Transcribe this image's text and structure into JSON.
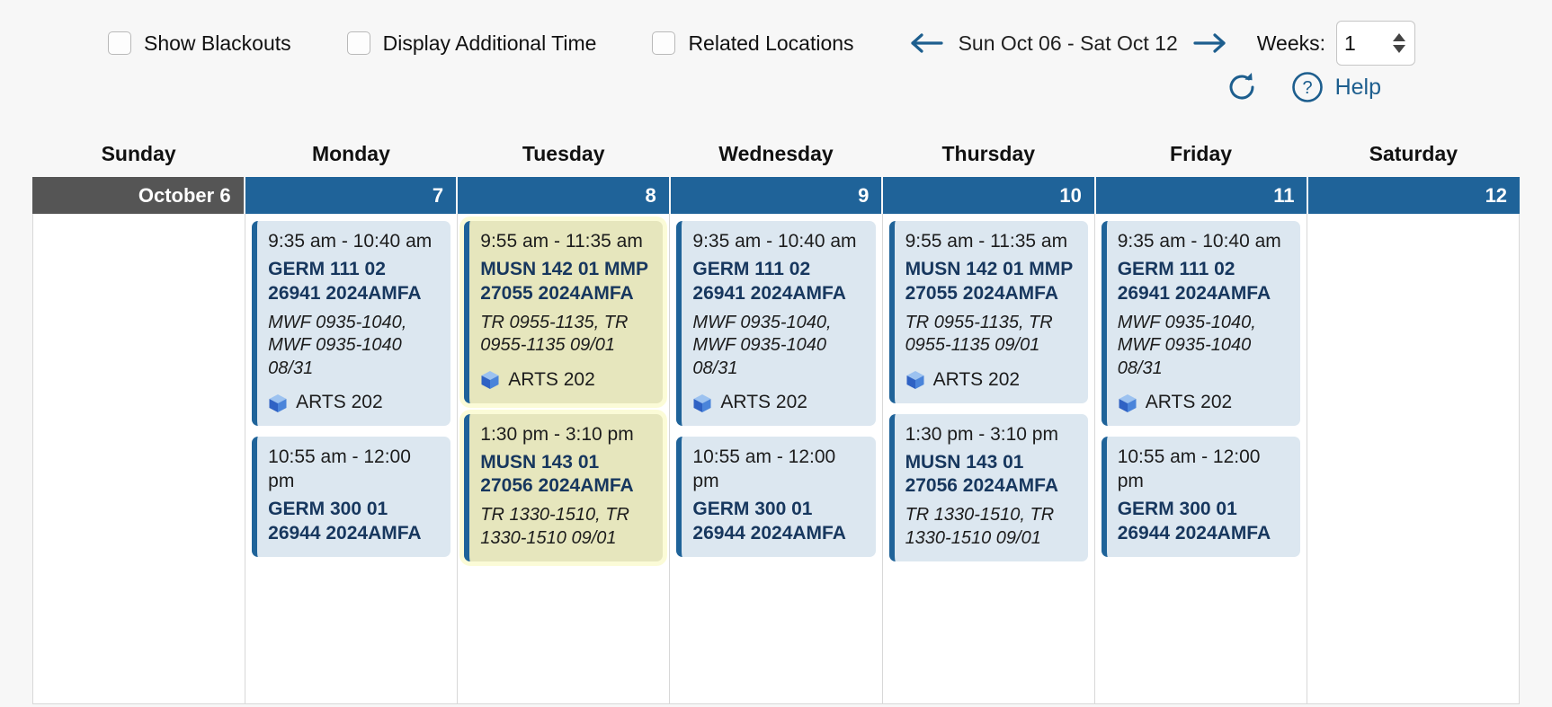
{
  "toolbar": {
    "checkboxes": [
      {
        "label": "Show Blackouts",
        "checked": false
      },
      {
        "label": "Display Additional Time",
        "checked": false
      },
      {
        "label": "Related Locations",
        "checked": false
      }
    ],
    "prev_icon": "arrow-left-icon",
    "next_icon": "arrow-right-icon",
    "week_range": "Sun Oct 06 - Sat Oct 12",
    "weeks_label": "Weeks:",
    "weeks_value": "1"
  },
  "actions": {
    "refresh_icon": "refresh-icon",
    "help_icon": "question-circle-icon",
    "help_label": "Help"
  },
  "colors": {
    "header_blue": "#1f6399",
    "today_gray": "#555555",
    "event_blue": "#dce7f0",
    "event_olive": "#e6e6bd",
    "accent_link": "#1d5e8e",
    "title_navy": "#17375e"
  },
  "calendar": {
    "day_names": [
      "Sunday",
      "Monday",
      "Tuesday",
      "Wednesday",
      "Thursday",
      "Friday",
      "Saturday"
    ],
    "days": [
      {
        "date_label": "October 6",
        "is_today": true,
        "events": []
      },
      {
        "date_label": "7",
        "is_today": false,
        "events": [
          {
            "time": "9:35 am  - 10:40 am",
            "title": "GERM 111 02 26941 2024AMFA",
            "meta": "MWF 0935-1040, MWF 0935-1040 08/31",
            "location": "ARTS 202",
            "location_icon": "cube-icon",
            "style": "blue"
          },
          {
            "time": "10:55 am  - 12:00 pm",
            "title": "GERM 300 01 26944 2024AMFA",
            "meta": "",
            "location": "",
            "location_icon": "cube-icon",
            "style": "blue"
          }
        ]
      },
      {
        "date_label": "8",
        "is_today": false,
        "events": [
          {
            "time": "9:55 am - 11:35 am",
            "title": "MUSN 142 01 MMP 27055 2024AMFA",
            "meta": "TR 0955-1135, TR 0955-1135 09/01",
            "location": "ARTS 202",
            "location_icon": "cube-icon",
            "style": "olive"
          },
          {
            "time": "1:30 pm - 3:10 pm",
            "title": "MUSN 143 01 27056 2024AMFA",
            "meta": "TR 1330-1510, TR 1330-1510 09/01",
            "location": "",
            "location_icon": "cube-icon",
            "style": "olive"
          }
        ]
      },
      {
        "date_label": "9",
        "is_today": false,
        "events": [
          {
            "time": "9:35 am  - 10:40 am",
            "title": "GERM 111 02 26941 2024AMFA",
            "meta": "MWF 0935-1040, MWF 0935-1040 08/31",
            "location": "ARTS 202",
            "location_icon": "cube-icon",
            "style": "blue"
          },
          {
            "time": "10:55 am  - 12:00 pm",
            "title": "GERM 300 01 26944 2024AMFA",
            "meta": "",
            "location": "",
            "location_icon": "cube-icon",
            "style": "blue"
          }
        ]
      },
      {
        "date_label": "10",
        "is_today": false,
        "events": [
          {
            "time": "9:55 am - 11:35 am",
            "title": "MUSN 142 01 MMP 27055 2024AMFA",
            "meta": "TR 0955-1135, TR 0955-1135 09/01",
            "location": "ARTS 202",
            "location_icon": "cube-icon",
            "style": "blue"
          },
          {
            "time": "1:30 pm - 3:10 pm",
            "title": "MUSN 143 01 27056 2024AMFA",
            "meta": "TR 1330-1510, TR 1330-1510 09/01",
            "location": "",
            "location_icon": "cube-icon",
            "style": "blue"
          }
        ]
      },
      {
        "date_label": "11",
        "is_today": false,
        "events": [
          {
            "time": "9:35 am  - 10:40 am",
            "title": "GERM 111 02 26941 2024AMFA",
            "meta": "MWF 0935-1040, MWF 0935-1040 08/31",
            "location": "ARTS 202",
            "location_icon": "cube-icon",
            "style": "blue"
          },
          {
            "time": "10:55 am  - 12:00 pm",
            "title": "GERM 300 01 26944 2024AMFA",
            "meta": "",
            "location": "",
            "location_icon": "cube-icon",
            "style": "blue"
          }
        ]
      },
      {
        "date_label": "12",
        "is_today": false,
        "events": []
      }
    ]
  }
}
